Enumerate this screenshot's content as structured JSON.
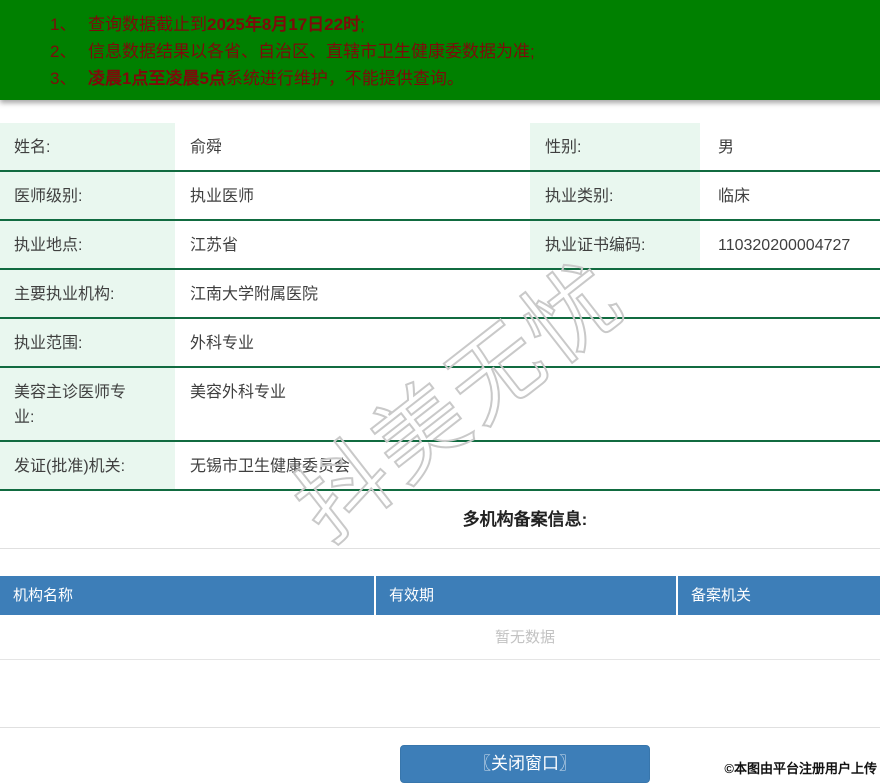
{
  "notice": {
    "items": [
      {
        "num": "1、",
        "pre": "查询数据截止到",
        "bold": "2025年8月17日22时",
        "post": ";"
      },
      {
        "num": "2、",
        "pre": "信息数据结果以各省、自治区、直辖市卫生健康委数据为准;",
        "bold": "",
        "post": ""
      },
      {
        "num": "3、",
        "pre": "",
        "bold": "凌晨1点至凌晨5点",
        "post": "系统进行维护，不能提供查询。"
      }
    ]
  },
  "profile": {
    "rows": [
      {
        "label": "姓名:",
        "value": "俞舜",
        "label2": "性别:",
        "value2": "男"
      },
      {
        "label": "医师级别:",
        "value": "执业医师",
        "label2": "执业类别:",
        "value2": "临床"
      },
      {
        "label": "执业地点:",
        "value": "江苏省",
        "label2": "执业证书编码:",
        "value2": "110320200004727"
      },
      {
        "label": "主要执业机构:",
        "value": "江南大学附属医院"
      },
      {
        "label": "执业范围:",
        "value": "外科专业"
      },
      {
        "label": "美容主诊医师专业:",
        "value": "美容外科专业"
      },
      {
        "label": "发证(批准)机关:",
        "value": "无锡市卫生健康委员会"
      }
    ]
  },
  "records": {
    "title": "多机构备案信息:",
    "headers": [
      "机构名称",
      "有效期",
      "备案机关"
    ],
    "empty_text": "暂无数据"
  },
  "footer": {
    "close_button": "〖关闭窗口〗",
    "attribution": "©本图由平台注册用户上传"
  },
  "watermark": "抖美无忧",
  "colors": {
    "banner_green": "#008000",
    "notice_text": "#7d0b0b",
    "table_border_green": "#116b40",
    "label_cell_bg": "#e9f7ef",
    "header_blue": "#3d7eb8",
    "button_blue": "#3d7eb8",
    "empty_text_gray": "#c2c2c2"
  }
}
